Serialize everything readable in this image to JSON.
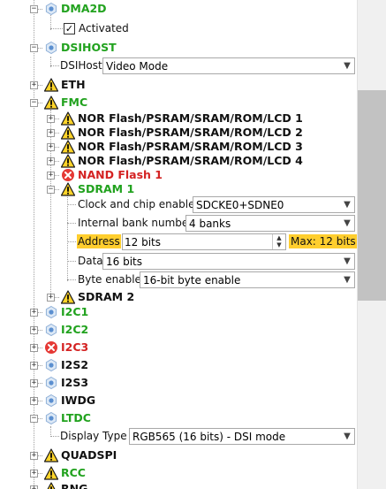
{
  "tree": {
    "dma2d": {
      "label": "DMA2D",
      "activated_label": "Activated"
    },
    "dsihost": {
      "label": "DSIHOST",
      "param_label": "DSIHost",
      "param_value": "Video Mode"
    },
    "eth": {
      "label": "ETH"
    },
    "fmc": {
      "label": "FMC",
      "children": [
        "NOR Flash/PSRAM/SRAM/ROM/LCD 1",
        "NOR Flash/PSRAM/SRAM/ROM/LCD 2",
        "NOR Flash/PSRAM/SRAM/ROM/LCD 3",
        "NOR Flash/PSRAM/SRAM/ROM/LCD 4"
      ],
      "nand": "NAND Flash 1",
      "sdram1": {
        "label": "SDRAM 1",
        "clock_label": "Clock and chip enable",
        "clock_value": "SDCKE0+SDNE0",
        "bank_label": "Internal bank number",
        "bank_value": "4 banks",
        "address_label": "Address",
        "address_value": "12 bits",
        "address_max": "Max: 12 bits",
        "data_label": "Data",
        "data_value": "16 bits",
        "byte_label": "Byte enable",
        "byte_value": "16-bit byte enable"
      },
      "sdram2": "SDRAM 2"
    },
    "i2c1": "I2C1",
    "i2c2": "I2C2",
    "i2c3": "I2C3",
    "i2s2": "I2S2",
    "i2s3": "I2S3",
    "iwdg": "IWDG",
    "ltdc": {
      "label": "LTDC",
      "param_label": "Display Type",
      "param_value": "RGB565 (16 bits) - DSI mode"
    },
    "quadspi": "QUADSPI",
    "rcc": "RCC",
    "rng": "RNG"
  },
  "icons": {
    "ok": "gear-ok-icon",
    "warn": "warning-icon",
    "error": "error-icon"
  },
  "colors": {
    "ok_text": "#21a21e",
    "error_text": "#d42222",
    "highlight": "#ffce2e"
  }
}
